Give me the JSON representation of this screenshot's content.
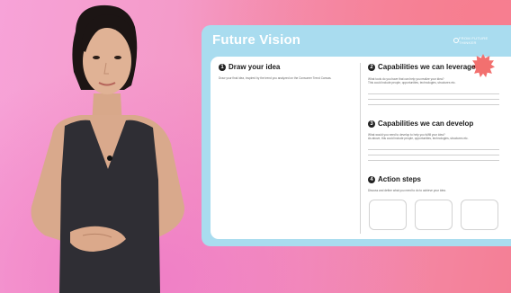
{
  "board": {
    "title": "Future Vision",
    "brand_line1": "FROM FUTURE",
    "brand_line2": "THINKER",
    "sections": [
      {
        "number": "1",
        "title": "Draw your idea",
        "desc": "Draw your final idea, inspired by the trend you analyzed on the Consumer Trend Canvas."
      },
      {
        "number": "2",
        "title": "Capabilities we can leverage",
        "desc": "What tools do you have that can help you realize your idea?",
        "desc2": "This could include people, opportunities, technologies, structures etc."
      },
      {
        "number": "3",
        "title": "Capabilities we can develop",
        "desc": "What would you need to develop to help you fulfill your idea?",
        "desc2": "As above, this could include people, opportunities, technologies, structures etc."
      },
      {
        "number": "4",
        "title": "Action steps",
        "desc": "Discuss and define what you need to do to achieve your idea."
      }
    ]
  },
  "colors": {
    "board": "#a9dcef",
    "accent_burst": "#f2706f",
    "background": "#f49ac8"
  }
}
